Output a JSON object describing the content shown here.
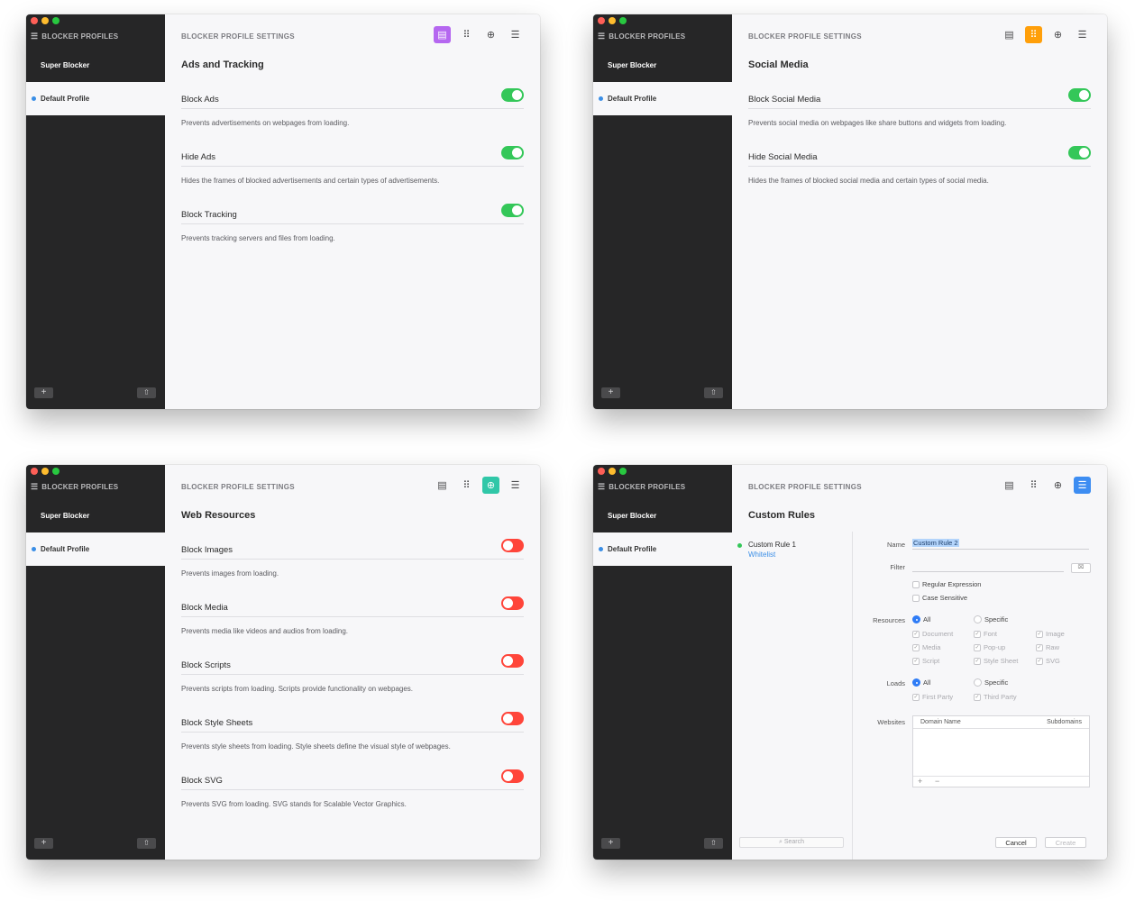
{
  "common": {
    "sidebar_title": "BLOCKER PROFILES",
    "brand": "Super Blocker",
    "profile": "Default Profile",
    "main_title": "BLOCKER PROFILE SETTINGS",
    "add_glyph": "+",
    "share_glyph": "⇧",
    "list_glyph": "☰",
    "toolbar_glyphs": [
      "▤",
      "⠿",
      "⊕",
      "☰"
    ]
  },
  "accent_colors": {
    "ads": "#b567f0",
    "social": "#ff9f0a",
    "web": "#30c7a8",
    "custom": "#3d8df2",
    "toggle_on": "#34c759",
    "toggle_off": "#ff453a"
  },
  "window1": {
    "section": "Ads and Tracking",
    "rows": [
      {
        "label": "Block Ads",
        "desc": "Prevents advertisements on webpages from loading.",
        "on": true
      },
      {
        "label": "Hide Ads",
        "desc": "Hides the frames of blocked advertisements and certain types of advertisements.",
        "on": true
      },
      {
        "label": "Block Tracking",
        "desc": "Prevents tracking servers and files from loading.",
        "on": true
      }
    ]
  },
  "window2": {
    "section": "Social Media",
    "rows": [
      {
        "label": "Block Social Media",
        "desc": "Prevents social media on webpages like share buttons and widgets from loading.",
        "on": true
      },
      {
        "label": "Hide Social Media",
        "desc": "Hides the frames of blocked social media and certain types of social media.",
        "on": true
      }
    ]
  },
  "window3": {
    "section": "Web Resources",
    "rows": [
      {
        "label": "Block Images",
        "desc": "Prevents images from loading.",
        "on": false
      },
      {
        "label": "Block Media",
        "desc": "Prevents media like videos and audios from loading.",
        "on": false
      },
      {
        "label": "Block Scripts",
        "desc": "Prevents scripts from loading. Scripts provide functionality on webpages.",
        "on": false
      },
      {
        "label": "Block Style Sheets",
        "desc": "Prevents style sheets from loading. Style sheets define the visual style of webpages.",
        "on": false
      },
      {
        "label": "Block SVG",
        "desc": "Prevents SVG from loading. SVG stands for Scalable Vector Graphics.",
        "on": false
      }
    ]
  },
  "window4": {
    "section": "Custom Rules",
    "rule_name": "Custom Rule 1",
    "rule_type": "Whitelist",
    "search_placeholder": "Search",
    "name_label": "Name",
    "name_value": "Custom Rule 2",
    "filter_label": "Filter",
    "filter_button": "⌧",
    "regex": "Regular Expression",
    "case": "Case Sensitive",
    "resources_label": "Resources",
    "all": "All",
    "specific": "Specific",
    "resource_types": [
      "Document",
      "Font",
      "Image",
      "Media",
      "Pop-up",
      "Raw",
      "Script",
      "Style Sheet",
      "SVG"
    ],
    "loads_label": "Loads",
    "load_types": [
      "First Party",
      "Third Party"
    ],
    "websites_label": "Websites",
    "col_domain": "Domain Name",
    "col_subdomains": "Subdomains",
    "cancel": "Cancel",
    "create": "Create"
  }
}
